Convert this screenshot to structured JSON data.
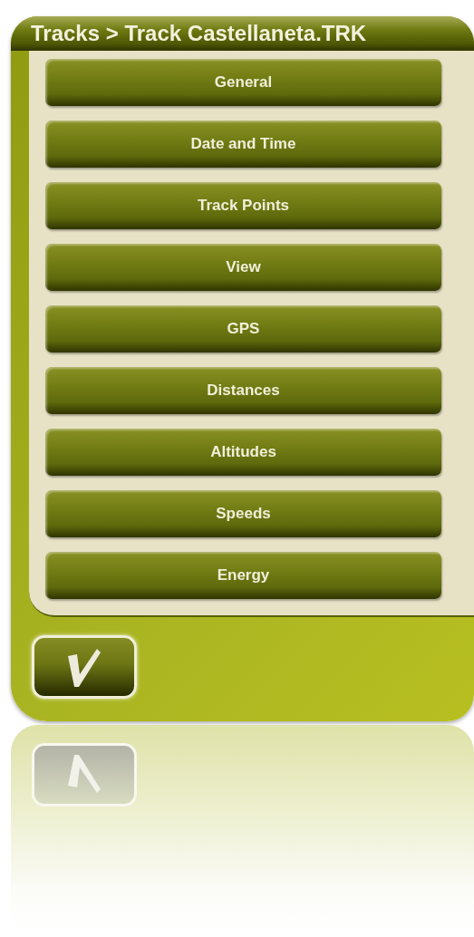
{
  "title": "Tracks > Track Castellaneta.TRK",
  "menu": [
    {
      "label": "General"
    },
    {
      "label": "Date and Time"
    },
    {
      "label": "Track Points"
    },
    {
      "label": "View"
    },
    {
      "label": "GPS"
    },
    {
      "label": "Distances"
    },
    {
      "label": "Altitudes"
    },
    {
      "label": "Speeds"
    },
    {
      "label": "Energy"
    }
  ]
}
